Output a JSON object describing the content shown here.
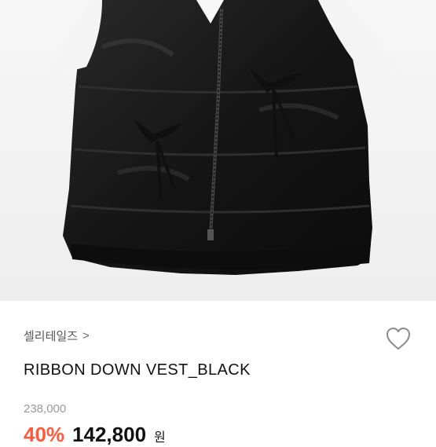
{
  "product": {
    "brand": "셀리테일즈",
    "brand_chevron": ">",
    "title": "RIBBON DOWN VEST_BLACK",
    "original_price": "238,000",
    "discount": "40%",
    "sale_price": "142,800",
    "currency": "원"
  },
  "icons": {
    "brand_arrow": "chevron-right-icon",
    "wishlist": "heart-outline-icon"
  },
  "colors": {
    "discount": "#ff5a3c",
    "text": "#111111",
    "muted": "#9a9a9a"
  }
}
